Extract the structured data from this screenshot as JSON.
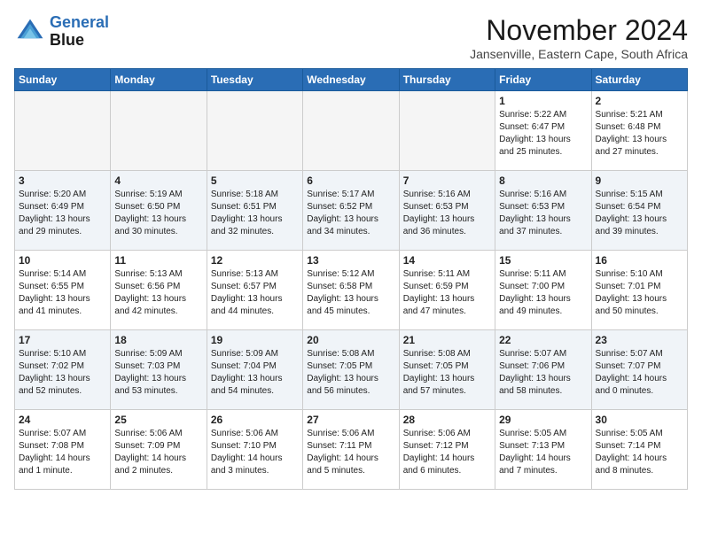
{
  "header": {
    "logo_line1": "General",
    "logo_line2": "Blue",
    "month": "November 2024",
    "location": "Jansenville, Eastern Cape, South Africa"
  },
  "weekdays": [
    "Sunday",
    "Monday",
    "Tuesday",
    "Wednesday",
    "Thursday",
    "Friday",
    "Saturday"
  ],
  "weeks": [
    [
      {
        "day": "",
        "info": ""
      },
      {
        "day": "",
        "info": ""
      },
      {
        "day": "",
        "info": ""
      },
      {
        "day": "",
        "info": ""
      },
      {
        "day": "",
        "info": ""
      },
      {
        "day": "1",
        "info": "Sunrise: 5:22 AM\nSunset: 6:47 PM\nDaylight: 13 hours and 25 minutes."
      },
      {
        "day": "2",
        "info": "Sunrise: 5:21 AM\nSunset: 6:48 PM\nDaylight: 13 hours and 27 minutes."
      }
    ],
    [
      {
        "day": "3",
        "info": "Sunrise: 5:20 AM\nSunset: 6:49 PM\nDaylight: 13 hours and 29 minutes."
      },
      {
        "day": "4",
        "info": "Sunrise: 5:19 AM\nSunset: 6:50 PM\nDaylight: 13 hours and 30 minutes."
      },
      {
        "day": "5",
        "info": "Sunrise: 5:18 AM\nSunset: 6:51 PM\nDaylight: 13 hours and 32 minutes."
      },
      {
        "day": "6",
        "info": "Sunrise: 5:17 AM\nSunset: 6:52 PM\nDaylight: 13 hours and 34 minutes."
      },
      {
        "day": "7",
        "info": "Sunrise: 5:16 AM\nSunset: 6:53 PM\nDaylight: 13 hours and 36 minutes."
      },
      {
        "day": "8",
        "info": "Sunrise: 5:16 AM\nSunset: 6:53 PM\nDaylight: 13 hours and 37 minutes."
      },
      {
        "day": "9",
        "info": "Sunrise: 5:15 AM\nSunset: 6:54 PM\nDaylight: 13 hours and 39 minutes."
      }
    ],
    [
      {
        "day": "10",
        "info": "Sunrise: 5:14 AM\nSunset: 6:55 PM\nDaylight: 13 hours and 41 minutes."
      },
      {
        "day": "11",
        "info": "Sunrise: 5:13 AM\nSunset: 6:56 PM\nDaylight: 13 hours and 42 minutes."
      },
      {
        "day": "12",
        "info": "Sunrise: 5:13 AM\nSunset: 6:57 PM\nDaylight: 13 hours and 44 minutes."
      },
      {
        "day": "13",
        "info": "Sunrise: 5:12 AM\nSunset: 6:58 PM\nDaylight: 13 hours and 45 minutes."
      },
      {
        "day": "14",
        "info": "Sunrise: 5:11 AM\nSunset: 6:59 PM\nDaylight: 13 hours and 47 minutes."
      },
      {
        "day": "15",
        "info": "Sunrise: 5:11 AM\nSunset: 7:00 PM\nDaylight: 13 hours and 49 minutes."
      },
      {
        "day": "16",
        "info": "Sunrise: 5:10 AM\nSunset: 7:01 PM\nDaylight: 13 hours and 50 minutes."
      }
    ],
    [
      {
        "day": "17",
        "info": "Sunrise: 5:10 AM\nSunset: 7:02 PM\nDaylight: 13 hours and 52 minutes."
      },
      {
        "day": "18",
        "info": "Sunrise: 5:09 AM\nSunset: 7:03 PM\nDaylight: 13 hours and 53 minutes."
      },
      {
        "day": "19",
        "info": "Sunrise: 5:09 AM\nSunset: 7:04 PM\nDaylight: 13 hours and 54 minutes."
      },
      {
        "day": "20",
        "info": "Sunrise: 5:08 AM\nSunset: 7:05 PM\nDaylight: 13 hours and 56 minutes."
      },
      {
        "day": "21",
        "info": "Sunrise: 5:08 AM\nSunset: 7:05 PM\nDaylight: 13 hours and 57 minutes."
      },
      {
        "day": "22",
        "info": "Sunrise: 5:07 AM\nSunset: 7:06 PM\nDaylight: 13 hours and 58 minutes."
      },
      {
        "day": "23",
        "info": "Sunrise: 5:07 AM\nSunset: 7:07 PM\nDaylight: 14 hours and 0 minutes."
      }
    ],
    [
      {
        "day": "24",
        "info": "Sunrise: 5:07 AM\nSunset: 7:08 PM\nDaylight: 14 hours and 1 minute."
      },
      {
        "day": "25",
        "info": "Sunrise: 5:06 AM\nSunset: 7:09 PM\nDaylight: 14 hours and 2 minutes."
      },
      {
        "day": "26",
        "info": "Sunrise: 5:06 AM\nSunset: 7:10 PM\nDaylight: 14 hours and 3 minutes."
      },
      {
        "day": "27",
        "info": "Sunrise: 5:06 AM\nSunset: 7:11 PM\nDaylight: 14 hours and 5 minutes."
      },
      {
        "day": "28",
        "info": "Sunrise: 5:06 AM\nSunset: 7:12 PM\nDaylight: 14 hours and 6 minutes."
      },
      {
        "day": "29",
        "info": "Sunrise: 5:05 AM\nSunset: 7:13 PM\nDaylight: 14 hours and 7 minutes."
      },
      {
        "day": "30",
        "info": "Sunrise: 5:05 AM\nSunset: 7:14 PM\nDaylight: 14 hours and 8 minutes."
      }
    ]
  ]
}
